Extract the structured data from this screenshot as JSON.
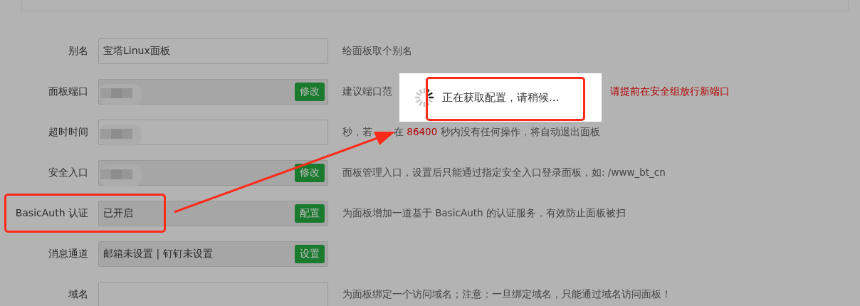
{
  "rows": [
    {
      "label": "别名",
      "value": "宝塔Linux面板",
      "readonly": false,
      "redacted": false,
      "hint": [
        {
          "text": "给面板取个别名",
          "kind": "normal"
        }
      ]
    },
    {
      "label": "面板端口",
      "readonly": true,
      "redacted": true,
      "button": "修改",
      "hint": [
        {
          "text": "建议端口范",
          "kind": "normal"
        },
        {
          "text": "请提前在安全组放行新端口",
          "kind": "warn",
          "after_dialog": true
        }
      ]
    },
    {
      "label": "超时时间",
      "readonly": false,
      "redacted": true,
      "hint": [
        {
          "text": "秒，若",
          "kind": "normal"
        },
        {
          "text": "在 ",
          "kind": "normal",
          "after_arrow": true
        },
        {
          "text": "86400",
          "kind": "warn"
        },
        {
          "text": " 秒内没有任何操作，将自动退出面板",
          "kind": "normal"
        }
      ]
    },
    {
      "label": "安全入口",
      "readonly": true,
      "redacted": true,
      "button": "修改",
      "hint": [
        {
          "text": "面板管理入口，设置后只能通过指定安全入口登录面板，如: /www_bt_cn",
          "kind": "normal"
        }
      ]
    },
    {
      "label": "BasicAuth 认证",
      "value": "已开启",
      "readonly": true,
      "redacted": false,
      "button": "配置",
      "hint": [
        {
          "text": "为面板增加一道基于 BasicAuth 的认证服务，有效防止面板被扫",
          "kind": "normal"
        }
      ]
    },
    {
      "label": "消息通道",
      "value": "邮箱未设置 | 钉钉未设置",
      "readonly": true,
      "redacted": false,
      "button": "设置"
    },
    {
      "label": "域名",
      "readonly": false,
      "redacted": false,
      "hint": [
        {
          "text": "为面板绑定一个访问域名；注意：一旦绑定域名，只能通过域名访问面板！",
          "kind": "normal"
        }
      ]
    }
  ],
  "loading": {
    "message": "正在获取配置，请稍候..."
  }
}
